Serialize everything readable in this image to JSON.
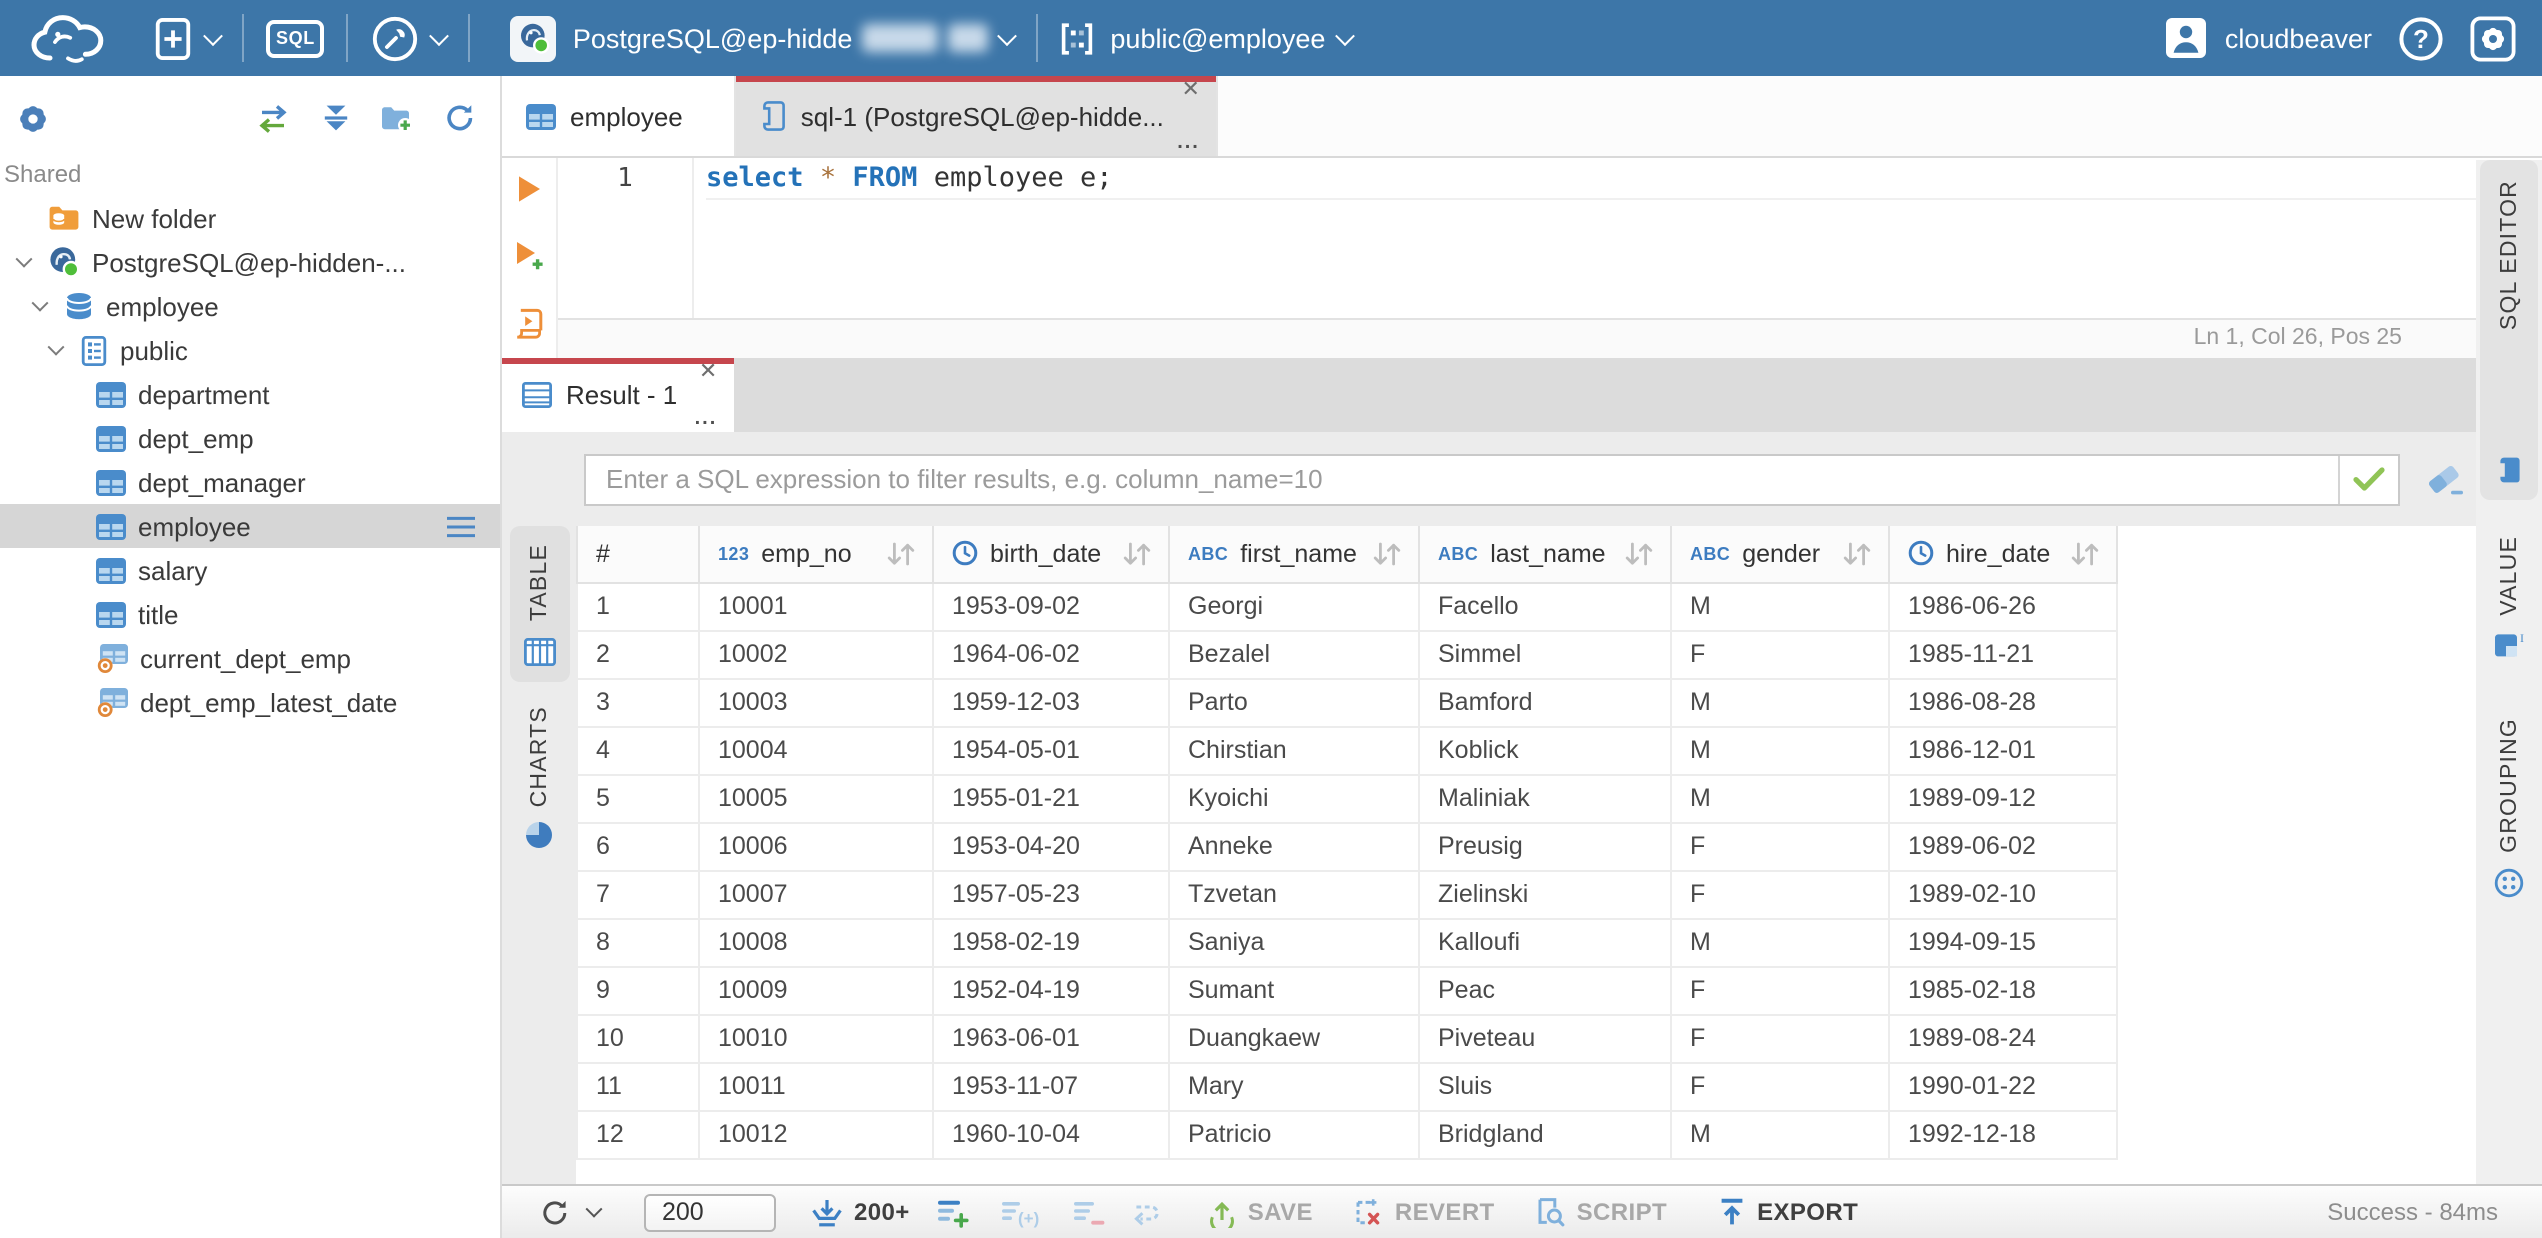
{
  "topbar": {
    "sql_badge": "SQL",
    "connection_label": "PostgreSQL@ep-hidde",
    "schema_label": "public@employee",
    "user_label": "cloudbeaver"
  },
  "sidebar": {
    "section_label": "Shared",
    "tree": [
      {
        "label": "New folder",
        "icon": "folder-db",
        "level": 1,
        "expanded": false,
        "selected": false
      },
      {
        "label": "PostgreSQL@ep-hidden-...",
        "icon": "postgres",
        "level": 1,
        "expanded": true,
        "selected": false
      },
      {
        "label": "employee",
        "icon": "database",
        "level": 2,
        "expanded": true,
        "selected": false
      },
      {
        "label": "public",
        "icon": "schema",
        "level": 3,
        "expanded": true,
        "selected": false
      },
      {
        "label": "department",
        "icon": "table",
        "level": 4,
        "expanded": false,
        "selected": false
      },
      {
        "label": "dept_emp",
        "icon": "table",
        "level": 4,
        "expanded": false,
        "selected": false
      },
      {
        "label": "dept_manager",
        "icon": "table",
        "level": 4,
        "expanded": false,
        "selected": false
      },
      {
        "label": "employee",
        "icon": "table",
        "level": 4,
        "expanded": false,
        "selected": true
      },
      {
        "label": "salary",
        "icon": "table",
        "level": 4,
        "expanded": false,
        "selected": false
      },
      {
        "label": "title",
        "icon": "table",
        "level": 4,
        "expanded": false,
        "selected": false
      },
      {
        "label": "current_dept_emp",
        "icon": "view",
        "level": 4,
        "expanded": false,
        "selected": false
      },
      {
        "label": "dept_emp_latest_date",
        "icon": "view",
        "level": 4,
        "expanded": false,
        "selected": false
      }
    ]
  },
  "editor_tabs": {
    "tab_table_label": "employee",
    "tab_sql_label": "sql-1 (PostgreSQL@ep-hidde..."
  },
  "sql_editor": {
    "line_number": "1",
    "tokens": [
      {
        "text": "select",
        "type": "keyword"
      },
      {
        "text": " ",
        "type": "plain"
      },
      {
        "text": "*",
        "type": "operator"
      },
      {
        "text": " ",
        "type": "plain"
      },
      {
        "text": "FROM",
        "type": "keyword"
      },
      {
        "text": " employee e;",
        "type": "plain"
      }
    ],
    "status": "Ln 1, Col 26, Pos 25"
  },
  "result": {
    "tab_label": "Result - 1",
    "filter_placeholder": "Enter a SQL expression to filter results, e.g. column_name=10",
    "left_tabs": [
      {
        "label": "TABLE",
        "active": true
      },
      {
        "label": "CHARTS",
        "active": false
      }
    ],
    "right_tabs": [
      {
        "label": "SQL EDITOR",
        "active": true
      },
      {
        "label": "VALUE",
        "active": false
      },
      {
        "label": "GROUPING",
        "active": false
      }
    ]
  },
  "grid": {
    "columns": [
      {
        "name": "#",
        "type": "rownum"
      },
      {
        "name": "emp_no",
        "type": "number"
      },
      {
        "name": "birth_date",
        "type": "datetime"
      },
      {
        "name": "first_name",
        "type": "string"
      },
      {
        "name": "last_name",
        "type": "string"
      },
      {
        "name": "gender",
        "type": "string"
      },
      {
        "name": "hire_date",
        "type": "datetime"
      }
    ],
    "rows": [
      [
        "1",
        "10001",
        "1953-09-02",
        "Georgi",
        "Facello",
        "M",
        "1986-06-26"
      ],
      [
        "2",
        "10002",
        "1964-06-02",
        "Bezalel",
        "Simmel",
        "F",
        "1985-11-21"
      ],
      [
        "3",
        "10003",
        "1959-12-03",
        "Parto",
        "Bamford",
        "M",
        "1986-08-28"
      ],
      [
        "4",
        "10004",
        "1954-05-01",
        "Chirstian",
        "Koblick",
        "M",
        "1986-12-01"
      ],
      [
        "5",
        "10005",
        "1955-01-21",
        "Kyoichi",
        "Maliniak",
        "M",
        "1989-09-12"
      ],
      [
        "6",
        "10006",
        "1953-04-20",
        "Anneke",
        "Preusig",
        "F",
        "1989-06-02"
      ],
      [
        "7",
        "10007",
        "1957-05-23",
        "Tzvetan",
        "Zielinski",
        "F",
        "1989-02-10"
      ],
      [
        "8",
        "10008",
        "1958-02-19",
        "Saniya",
        "Kalloufi",
        "M",
        "1994-09-15"
      ],
      [
        "9",
        "10009",
        "1952-04-19",
        "Sumant",
        "Peac",
        "F",
        "1985-02-18"
      ],
      [
        "10",
        "10010",
        "1963-06-01",
        "Duangkaew",
        "Piveteau",
        "F",
        "1989-08-24"
      ],
      [
        "11",
        "10011",
        "1953-11-07",
        "Mary",
        "Sluis",
        "F",
        "1990-01-22"
      ],
      [
        "12",
        "10012",
        "1960-10-04",
        "Patricio",
        "Bridgland",
        "M",
        "1992-12-18"
      ]
    ]
  },
  "toolbar": {
    "row_limit_value": "200",
    "fetch_more_label": "200+",
    "save_label": "SAVE",
    "revert_label": "REVERT",
    "script_label": "SCRIPT",
    "export_label": "EXPORT",
    "status": "Success - 84ms"
  },
  "colors": {
    "topbar_blue": "#3d76a8",
    "accent_red": "#c6464d",
    "icon_blue": "#4a8ccb",
    "keyword_blue": "#2472b8",
    "green": "#7cb342",
    "orange": "#ee8f39"
  }
}
